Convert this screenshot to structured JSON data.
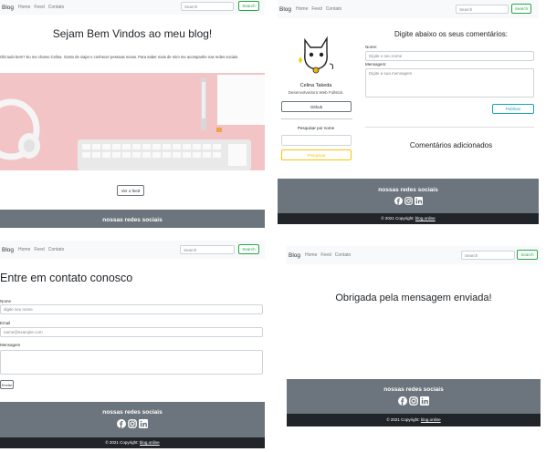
{
  "nav": {
    "brand": "Blog",
    "home": "Home",
    "feed": "Feed",
    "contact": "Contato",
    "search_placeholder": "Search",
    "search_button": "Search"
  },
  "home": {
    "title": "Sejam Bem Vindos ao meu blog!",
    "intro": "Olá tudo bem? Eu me chamo Celina. Gosto de viajar e conhecer pessoas novas. Para saber mais de mim me acompanhe nas redes sociais.",
    "feed_button": "Ver o feed",
    "footer_title": "nossas redes sociais"
  },
  "feed": {
    "profile_name": "Celina Takeda",
    "profile_role": "Desenvolvedora Web Fullstck.",
    "github_button": "Github",
    "search_label": "Pesquisar por nome",
    "search_button": "Pesquisar",
    "comments_title": "Digite abaixo os seus comentários:",
    "name_label": "Nome:",
    "name_placeholder": "Digite o seu nome",
    "message_label": "Mensagem:",
    "message_placeholder": "Digite a sua mensagem",
    "publish_button": "Publicar",
    "added_title": "Comentários adicionados",
    "footer_title": "nossas redes sociais",
    "copyright_prefix": "© 2021 Copyright: ",
    "copyright_link": "blog.online"
  },
  "contact": {
    "title": "Entre em contato conosco",
    "name_label": "Nome",
    "name_placeholder": "digite seu nome",
    "email_label": "Email",
    "email_placeholder": "name@example.com",
    "message_label": "Mensagem",
    "send_button": "Enviar",
    "footer_title": "nossas redes sociais",
    "copyright_prefix": "© 2021 Copyright: ",
    "copyright_link": "blog.online"
  },
  "thanks": {
    "message": "Obrigada pela mensagem enviada!",
    "footer_title": "nossas redes sociais",
    "copyright_prefix": "© 2021 Copyright: ",
    "copyright_link": "blog.online"
  },
  "icons": [
    "facebook-icon",
    "instagram-icon",
    "linkedin-icon"
  ],
  "colors": {
    "footer": "#6c757d",
    "copyright_bar": "#212529",
    "nav": "#f8f9fa",
    "search_button": "#28a745",
    "hero": "#f2c4c6"
  }
}
